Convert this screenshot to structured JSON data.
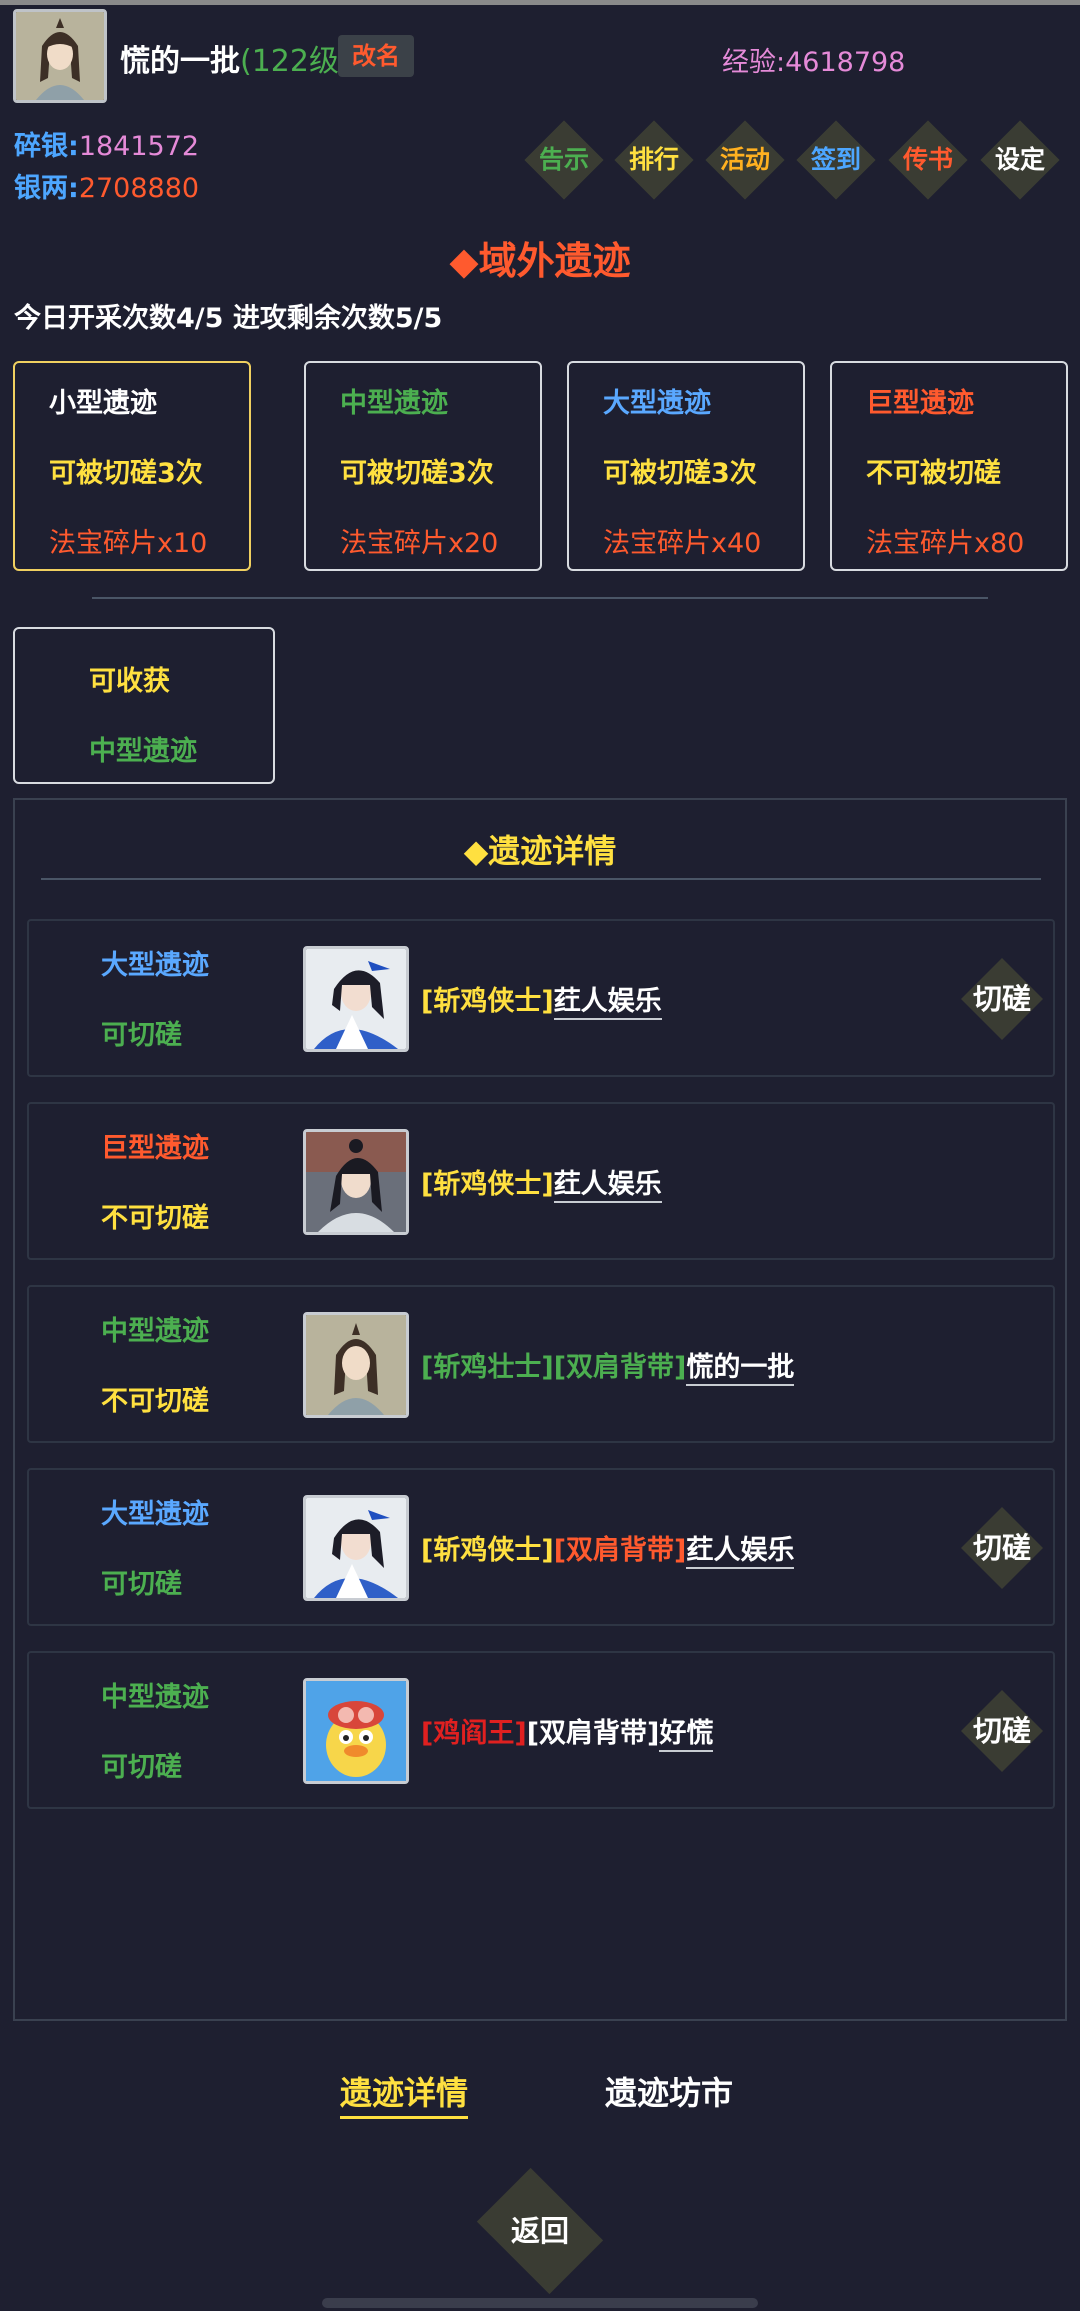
{
  "player": {
    "name": "慌的一批",
    "level": "(122级)",
    "rename_label": "改名",
    "exp_label": "经验:",
    "exp_value": "4618798",
    "silver_bits_label": "碎银:",
    "silver_bits_value": "1841572",
    "silver_taels_label": "银两:",
    "silver_taels_value": "2708880"
  },
  "menu": [
    {
      "label": "告示",
      "color": "#4caf50"
    },
    {
      "label": "排行",
      "color": "#ffe040"
    },
    {
      "label": "活动",
      "color": "#ffb020"
    },
    {
      "label": "签到",
      "color": "#4da6ff"
    },
    {
      "label": "传书",
      "color": "#ff5a2e"
    },
    {
      "label": "设定",
      "color": "#ffffff"
    }
  ],
  "page_title": "◆域外遗迹",
  "counts_text": "今日开采次数4/5  进攻剩余次数5/5",
  "ruin_types": [
    {
      "name": "小型遗迹",
      "status": "可被切磋3次",
      "reward": "法宝碎片x10",
      "name_color": "#ffffff"
    },
    {
      "name": "中型遗迹",
      "status": "可被切磋3次",
      "reward": "法宝碎片x20",
      "name_color": "#4caf50"
    },
    {
      "name": "大型遗迹",
      "status": "可被切磋3次",
      "reward": "法宝碎片x40",
      "name_color": "#5aa8ff"
    },
    {
      "name": "巨型遗迹",
      "status": "不可被切磋",
      "reward": "法宝碎片x80",
      "name_color": "#ff5a2e"
    }
  ],
  "harvest": {
    "label": "可收获",
    "type": "中型遗迹"
  },
  "detail": {
    "title": "◆遗迹详情",
    "spar_label": "切磋",
    "rows": [
      {
        "type": "大型遗迹",
        "status": "可切磋",
        "tags": [
          {
            "text": "[斩鸡侠士]",
            "color": "#ffe040"
          }
        ],
        "player": "荭人娱乐",
        "spar": true
      },
      {
        "type": "巨型遗迹",
        "status": "不可切磋",
        "tags": [
          {
            "text": "[斩鸡侠士]",
            "color": "#ffe040"
          }
        ],
        "player": "荭人娱乐",
        "spar": false
      },
      {
        "type": "中型遗迹",
        "status": "不可切磋",
        "tags": [
          {
            "text": "[斩鸡壮士]",
            "color": "#4caf50"
          },
          {
            "text": "[双肩背带]",
            "color": "#4caf50"
          }
        ],
        "player": "慌的一批",
        "spar": false
      },
      {
        "type": "大型遗迹",
        "status": "可切磋",
        "tags": [
          {
            "text": "[斩鸡侠士]",
            "color": "#ffe040"
          },
          {
            "text": "[双肩背带]",
            "color": "#ff5a2e"
          }
        ],
        "player": "荭人娱乐",
        "spar": true
      },
      {
        "type": "中型遗迹",
        "status": "可切磋",
        "tags": [
          {
            "text": "[鸡阎王]",
            "color": "#e02020"
          },
          {
            "text": "[双肩背带]",
            "color": "#ffffff"
          }
        ],
        "player": "好慌",
        "spar": true
      }
    ]
  },
  "tabs": {
    "details": "遗迹详情",
    "market": "遗迹坊市"
  },
  "back_label": "返回"
}
